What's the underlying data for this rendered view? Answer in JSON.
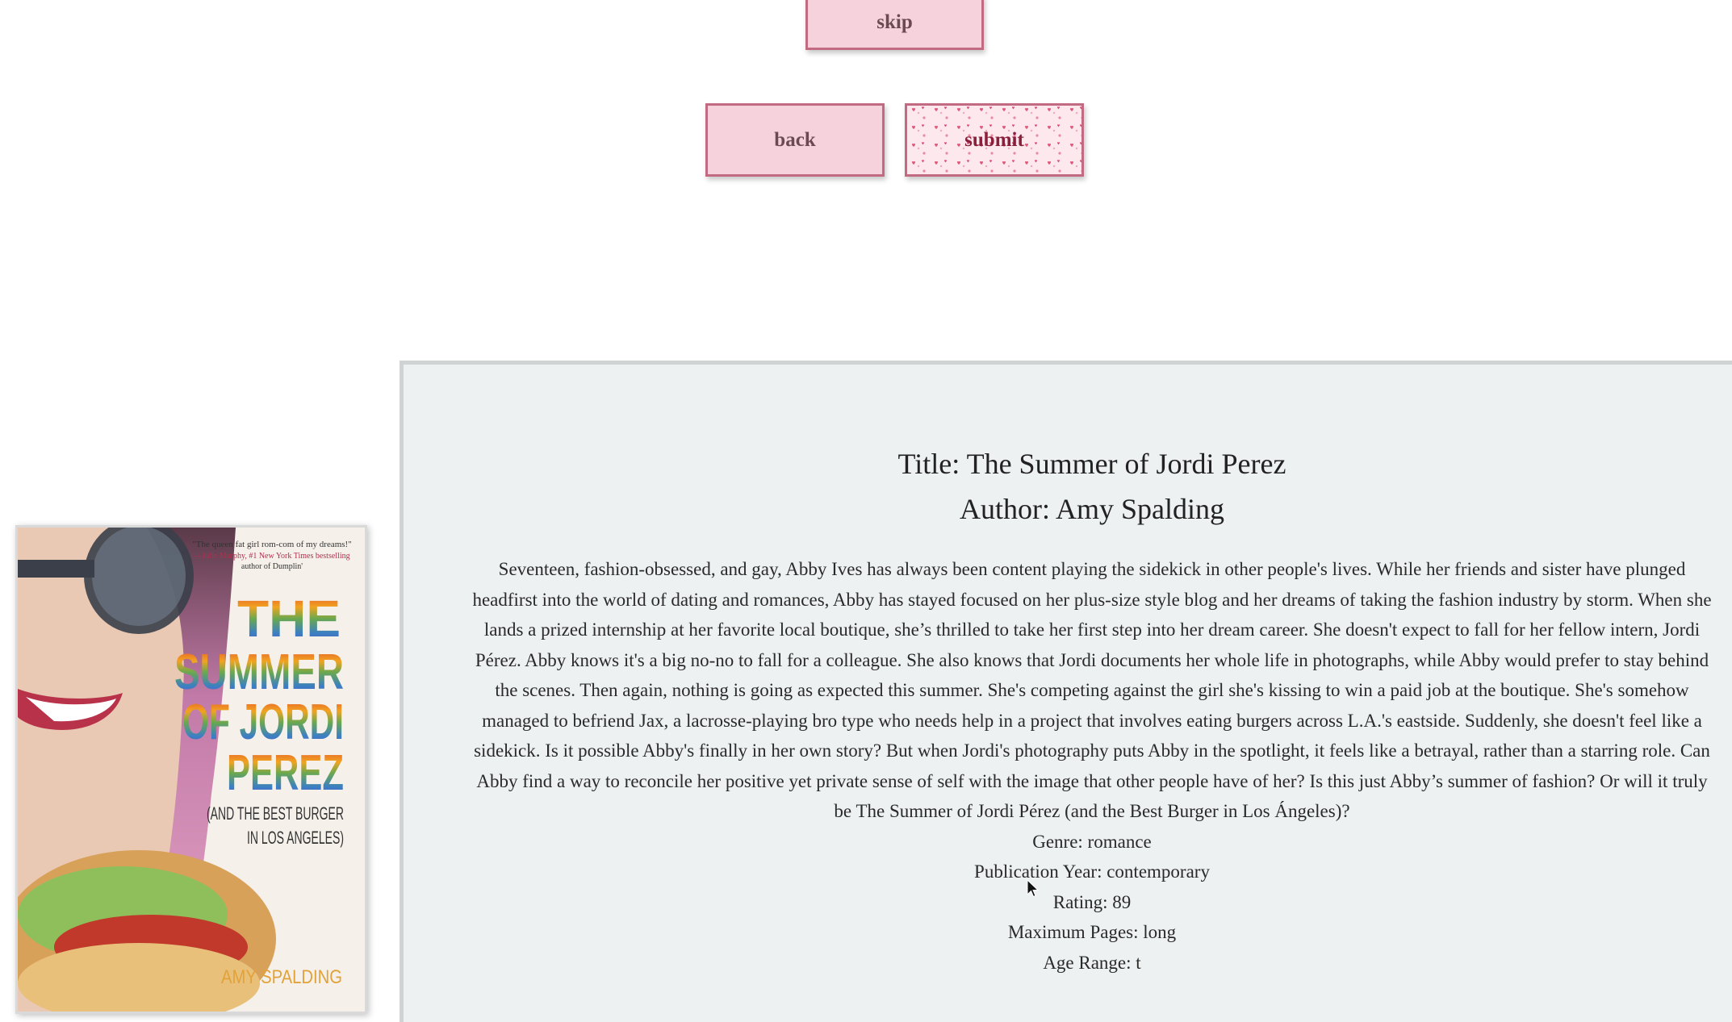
{
  "buttons": {
    "skip_label": "skip",
    "back_label": "back",
    "submit_label": "submit"
  },
  "book": {
    "title_line": "Title: The Summer of Jordi Perez",
    "author_line": "Author: Amy Spalding",
    "description": "Seventeen, fashion-obsessed, and gay, Abby Ives has always been content playing the sidekick in other people's lives. While her friends and sister have plunged headfirst into the world of dating and romances, Abby has stayed focused on her plus-size style blog and her dreams of taking the fashion industry by storm. When she lands a prized internship at her favorite local boutique, she’s thrilled to take her first step into her dream career. She doesn't expect to fall for her fellow intern, Jordi Pérez. Abby knows it's a big no-no to fall for a colleague. She also knows that Jordi documents her whole life in photographs, while Abby would prefer to stay behind the scenes. Then again, nothing is going as expected this summer. She's competing against the girl she's kissing to win a paid job at the boutique. She's somehow managed to befriend Jax, a lacrosse-playing bro type who needs help in a project that involves eating burgers across L.A.'s eastside. Suddenly, she doesn't feel like a sidekick. Is it possible Abby's finally in her own story? But when Jordi's photography puts Abby in the spotlight, it feels like a betrayal, rather than a starring role. Can Abby find a way to reconcile her positive yet private sense of self with the image that other people have of her? Is this just Abby’s summer of fashion? Or will it truly be The Summer of Jordi Pérez (and the Best Burger in Los Ángeles)?",
    "genre_line": "Genre: romance",
    "publication_line": "Publication Year: contemporary",
    "rating_line": "Rating: 89",
    "pages_line": "Maximum Pages: long",
    "age_line": "Age Range: t"
  },
  "cover": {
    "quote": "\"The queen fat girl rom-com of my dreams!\"",
    "quote_attr": "—Julie Murphy, #1 New York Times bestselling",
    "quote_attr2": "author of Dumplin'",
    "title_1": "THE",
    "title_2": "SUMMER",
    "title_3": "OF JORDI",
    "title_4": "PEREZ",
    "subtitle_1": "(AND THE BEST BURGER",
    "subtitle_2": "IN LOS ANGELES)",
    "author": "AMY SPALDING"
  },
  "colors": {
    "button_bg": "#f6d3dc",
    "button_border": "#c26a82",
    "panel_bg": "#eef1f1"
  },
  "icons": {
    "pointer": "mouse-pointer-icon"
  }
}
